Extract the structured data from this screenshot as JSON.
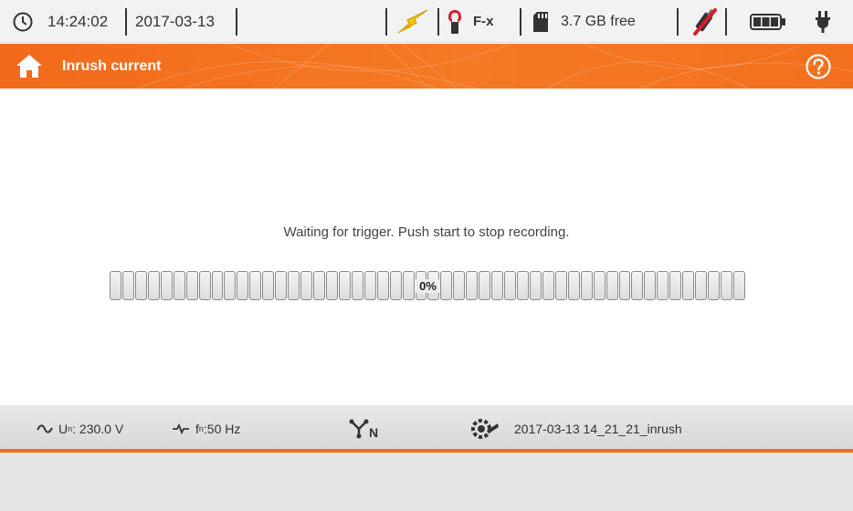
{
  "status": {
    "time": "14:24:02",
    "date": "2017-03-13",
    "clamp": "F-x",
    "storage": "3.7 GB free"
  },
  "header": {
    "title": "Inrush current"
  },
  "main": {
    "message": "Waiting for trigger. Push start to stop recording.",
    "progress_label": "0%",
    "progress_value": 0
  },
  "info": {
    "voltage_label": "U",
    "voltage_sub": "n",
    "voltage_value": ": 230.0 V",
    "freq_label": "f",
    "freq_sub": "n",
    "freq_value": ":50 Hz",
    "network_sub": "N",
    "recording_name": "2017-03-13 14_21_21_inrush"
  },
  "colors": {
    "accent": "#f26a1b",
    "help_button": "#ffffff"
  },
  "icons": {
    "clock": "clock-icon",
    "lightning": "lightning-icon",
    "clamp": "clamp-icon",
    "sd_card": "sd-card-icon",
    "usb": "usb-disconnected-icon",
    "battery": "battery-icon",
    "plug": "power-plug-icon",
    "home": "home-icon",
    "help": "help-icon",
    "sine": "sine-wave-icon",
    "frequency": "frequency-wave-icon",
    "network": "network-y-icon",
    "settings": "settings-gear-icon"
  }
}
